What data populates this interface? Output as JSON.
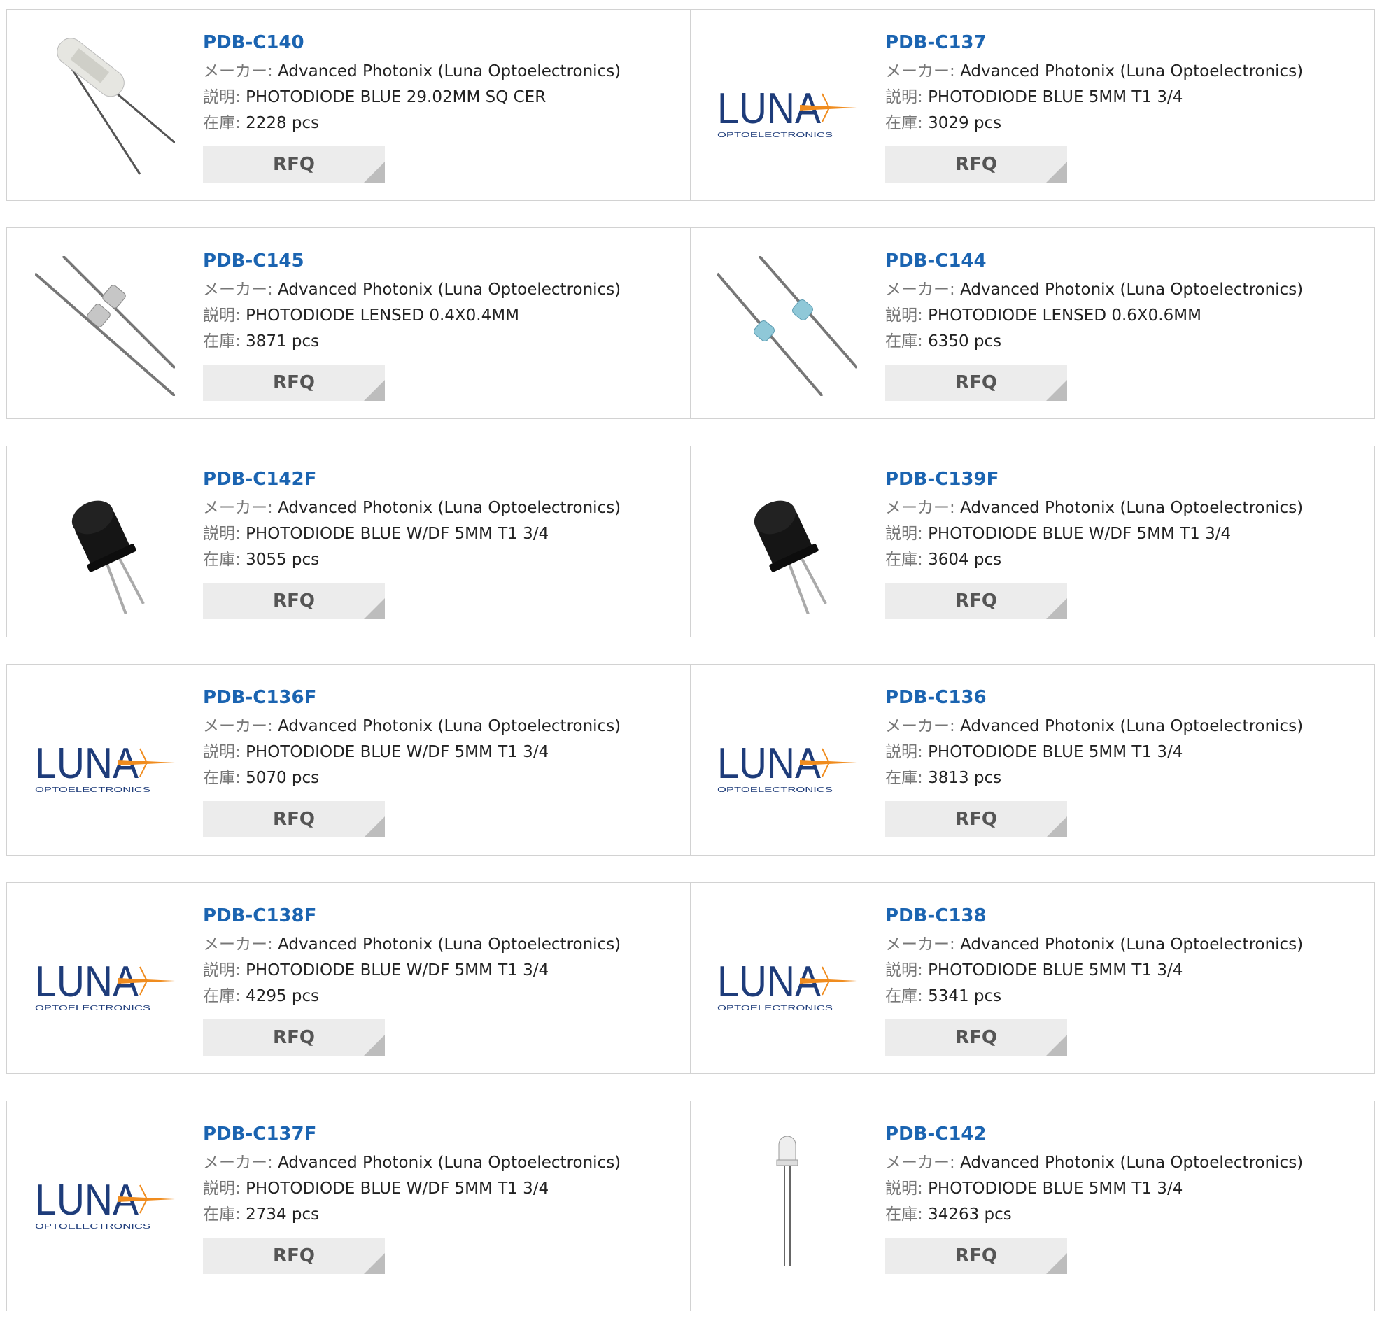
{
  "labels": {
    "maker": "メーカー:",
    "description": "説明:",
    "stock": "在庫:",
    "rfq": "RFQ"
  },
  "logo": {
    "brand": "LUNA",
    "tagline": "OPTOELECTRONICS"
  },
  "products": [
    {
      "name": "PDB-C140",
      "maker": "Advanced Photonix (Luna Optoelectronics)",
      "description": "PHOTODIODE BLUE 29.02MM SQ CER",
      "stock": "2228 pcs",
      "image": "ceramic-photodiode-icon"
    },
    {
      "name": "PDB-C137",
      "maker": "Advanced Photonix (Luna Optoelectronics)",
      "description": "PHOTODIODE BLUE 5MM T1 3/4",
      "stock": "3029 pcs",
      "image": "luna-logo"
    },
    {
      "name": "PDB-C145",
      "maker": "Advanced Photonix (Luna Optoelectronics)",
      "description": "PHOTODIODE LENSED 0.4X0.4MM",
      "stock": "3871 pcs",
      "image": "clear-lensed-diode-icon"
    },
    {
      "name": "PDB-C144",
      "maker": "Advanced Photonix (Luna Optoelectronics)",
      "description": "PHOTODIODE LENSED 0.6X0.6MM",
      "stock": "6350 pcs",
      "image": "blue-lensed-diode-icon"
    },
    {
      "name": "PDB-C142F",
      "maker": "Advanced Photonix (Luna Optoelectronics)",
      "description": "PHOTODIODE BLUE W/DF 5MM T1 3/4",
      "stock": "3055 pcs",
      "image": "black-led-icon"
    },
    {
      "name": "PDB-C139F",
      "maker": "Advanced Photonix (Luna Optoelectronics)",
      "description": "PHOTODIODE BLUE W/DF 5MM T1 3/4",
      "stock": "3604 pcs",
      "image": "black-led-icon"
    },
    {
      "name": "PDB-C136F",
      "maker": "Advanced Photonix (Luna Optoelectronics)",
      "description": "PHOTODIODE BLUE W/DF 5MM T1 3/4",
      "stock": "5070 pcs",
      "image": "luna-logo"
    },
    {
      "name": "PDB-C136",
      "maker": "Advanced Photonix (Luna Optoelectronics)",
      "description": "PHOTODIODE BLUE 5MM T1 3/4",
      "stock": "3813 pcs",
      "image": "luna-logo"
    },
    {
      "name": "PDB-C138F",
      "maker": "Advanced Photonix (Luna Optoelectronics)",
      "description": "PHOTODIODE BLUE W/DF 5MM T1 3/4",
      "stock": "4295 pcs",
      "image": "luna-logo"
    },
    {
      "name": "PDB-C138",
      "maker": "Advanced Photonix (Luna Optoelectronics)",
      "description": "PHOTODIODE BLUE 5MM T1 3/4",
      "stock": "5341 pcs",
      "image": "luna-logo"
    },
    {
      "name": "PDB-C137F",
      "maker": "Advanced Photonix (Luna Optoelectronics)",
      "description": "PHOTODIODE BLUE W/DF 5MM T1 3/4",
      "stock": "2734 pcs",
      "image": "luna-logo"
    },
    {
      "name": "PDB-C142",
      "maker": "Advanced Photonix (Luna Optoelectronics)",
      "description": "PHOTODIODE BLUE 5MM T1 3/4",
      "stock": "34263 pcs",
      "image": "clear-led-icon"
    }
  ],
  "colors": {
    "link": "#1b64b1",
    "rfq_bg": "#ececec",
    "border": "#d2d2d2",
    "logo_blue": "#1e3c7a",
    "logo_orange": "#f08c1e"
  }
}
